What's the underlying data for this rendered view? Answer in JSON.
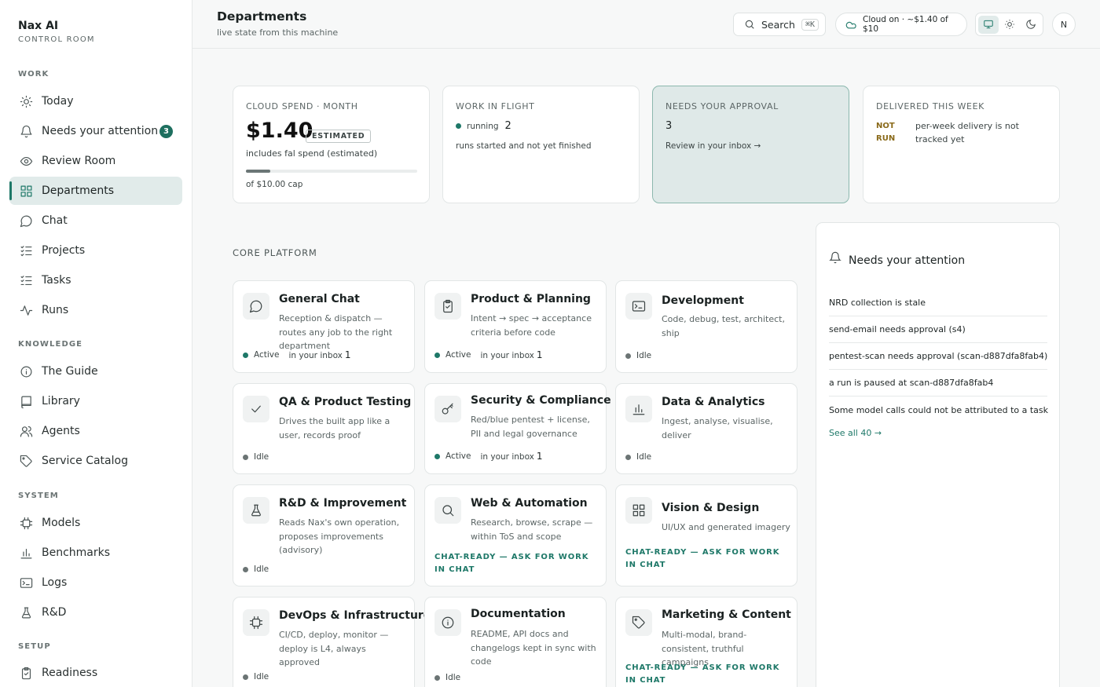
{
  "brand": {
    "name": "Nax AI",
    "subtitle": "CONTROL ROOM"
  },
  "sidebar": {
    "sections": [
      {
        "label": "WORK",
        "items": [
          {
            "label": "Today",
            "icon": "sun-icon"
          },
          {
            "label": "Needs your attention",
            "icon": "bell-icon",
            "badge": "3"
          },
          {
            "label": "Review Room",
            "icon": "eye-icon"
          },
          {
            "label": "Departments",
            "icon": "grid-icon",
            "active": true
          },
          {
            "label": "Chat",
            "icon": "chat-bubble-icon"
          },
          {
            "label": "Projects",
            "icon": "list-check-icon"
          },
          {
            "label": "Tasks",
            "icon": "task-list-icon"
          },
          {
            "label": "Runs",
            "icon": "activity-icon"
          }
        ]
      },
      {
        "label": "KNOWLEDGE",
        "items": [
          {
            "label": "The Guide",
            "icon": "info-icon"
          },
          {
            "label": "Library",
            "icon": "book-icon"
          },
          {
            "label": "Agents",
            "icon": "users-icon"
          },
          {
            "label": "Service Catalog",
            "icon": "tag-icon"
          }
        ]
      },
      {
        "label": "SYSTEM",
        "items": [
          {
            "label": "Models",
            "icon": "chip-icon"
          },
          {
            "label": "Benchmarks",
            "icon": "bar-chart-icon"
          },
          {
            "label": "Logs",
            "icon": "terminal-icon"
          },
          {
            "label": "R&D",
            "icon": "flask-icon"
          }
        ]
      },
      {
        "label": "SETUP",
        "items": [
          {
            "label": "Readiness",
            "icon": "clipboard-check-icon"
          }
        ]
      }
    ]
  },
  "header": {
    "title": "Departments",
    "subtitle": "live state from this machine",
    "search_label": "Search",
    "search_shortcut": "⌘K",
    "cloud_status": "Cloud on · ~$1.40 of $10",
    "theme_options": [
      "monitor-icon",
      "sun-icon",
      "moon-icon"
    ],
    "theme_selected": "monitor-icon",
    "avatar_initial": "N"
  },
  "stats": {
    "cloud_spend": {
      "label": "CLOUD SPEND · MONTH",
      "value": "$1.40",
      "badge": "ESTIMATED",
      "note": "includes fal spend (estimated)",
      "cap_note": "of $10.00 cap",
      "progress_fraction": 0.14
    },
    "work_in_flight": {
      "label": "WORK IN FLIGHT",
      "state": "running",
      "count": "2",
      "note": "runs started and not yet finished"
    },
    "needs_approval": {
      "label": "NEEDS YOUR APPROVAL",
      "count": "3",
      "link": "Review in your inbox →"
    },
    "delivered": {
      "label": "DELIVERED THIS WEEK",
      "status_line1": "NOT",
      "status_line2": "RUN",
      "note": "per-week delivery is not tracked yet"
    }
  },
  "core_platform": {
    "label": "CORE PLATFORM",
    "departments": [
      {
        "title": "General Chat",
        "desc": "Reception & dispatch — routes any job to the right department",
        "icon": "chat-bubble-icon",
        "status": "Active",
        "inbox_label": "in your inbox",
        "inbox_count": "1"
      },
      {
        "title": "Product & Planning",
        "desc": "Intent → spec → acceptance criteria before code",
        "icon": "clipboard-icon",
        "status": "Active",
        "inbox_label": "in your inbox",
        "inbox_count": "1"
      },
      {
        "title": "Development",
        "desc": "Code, debug, test, architect, ship",
        "icon": "terminal-icon",
        "status": "Idle"
      },
      {
        "title": "QA & Product Testing",
        "desc": "Drives the built app like a user, records proof",
        "icon": "check-icon",
        "status": "Idle"
      },
      {
        "title": "Security & Compliance",
        "desc": "Red/blue pentest + license, PII and legal governance",
        "icon": "key-icon",
        "status": "Active",
        "inbox_label": "in your inbox",
        "inbox_count": "1"
      },
      {
        "title": "Data & Analytics",
        "desc": "Ingest, analyse, visualise, deliver",
        "icon": "bar-chart-icon",
        "status": "Idle"
      },
      {
        "title": "R&D & Improvement",
        "desc": "Reads Nax's own operation, proposes improvements (advisory)",
        "icon": "flask-icon",
        "status": "Idle"
      },
      {
        "title": "Web & Automation",
        "desc": "Research, browse, scrape — within ToS and scope",
        "icon": "search-icon",
        "chat_ready": "CHAT-READY — ASK FOR WORK IN CHAT"
      },
      {
        "title": "Vision & Design",
        "desc": "UI/UX and generated imagery",
        "icon": "grid-icon",
        "chat_ready": "CHAT-READY — ASK FOR WORK IN CHAT"
      },
      {
        "title": "DevOps & Infrastructure",
        "desc": "CI/CD, deploy, monitor — deploy is L4, always approved",
        "icon": "chip-icon",
        "status": "Idle"
      },
      {
        "title": "Documentation",
        "desc": "README, API docs and changelogs kept in sync with code",
        "icon": "info-icon",
        "status": "Idle"
      },
      {
        "title": "Marketing & Content",
        "desc": "Multi-modal, brand-consistent, truthful campaigns",
        "icon": "tag-icon",
        "chat_ready": "CHAT-READY — ASK FOR WORK IN CHAT"
      }
    ]
  },
  "attention": {
    "title": "Needs your attention",
    "items": [
      "NRD collection is stale",
      "send-email needs approval (s4)",
      "pentest-scan needs approval (scan-d887dfa8fab4)",
      "a run is paused at scan-d887dfa8fab4",
      "Some model calls could not be attributed to a task"
    ],
    "see_all": "See all 40 →"
  },
  "colors": {
    "accent": "#1e7868",
    "badge": "#1e6f5f",
    "highlight_card": "#dfe9e8",
    "warning_text": "#8a6a1a"
  }
}
